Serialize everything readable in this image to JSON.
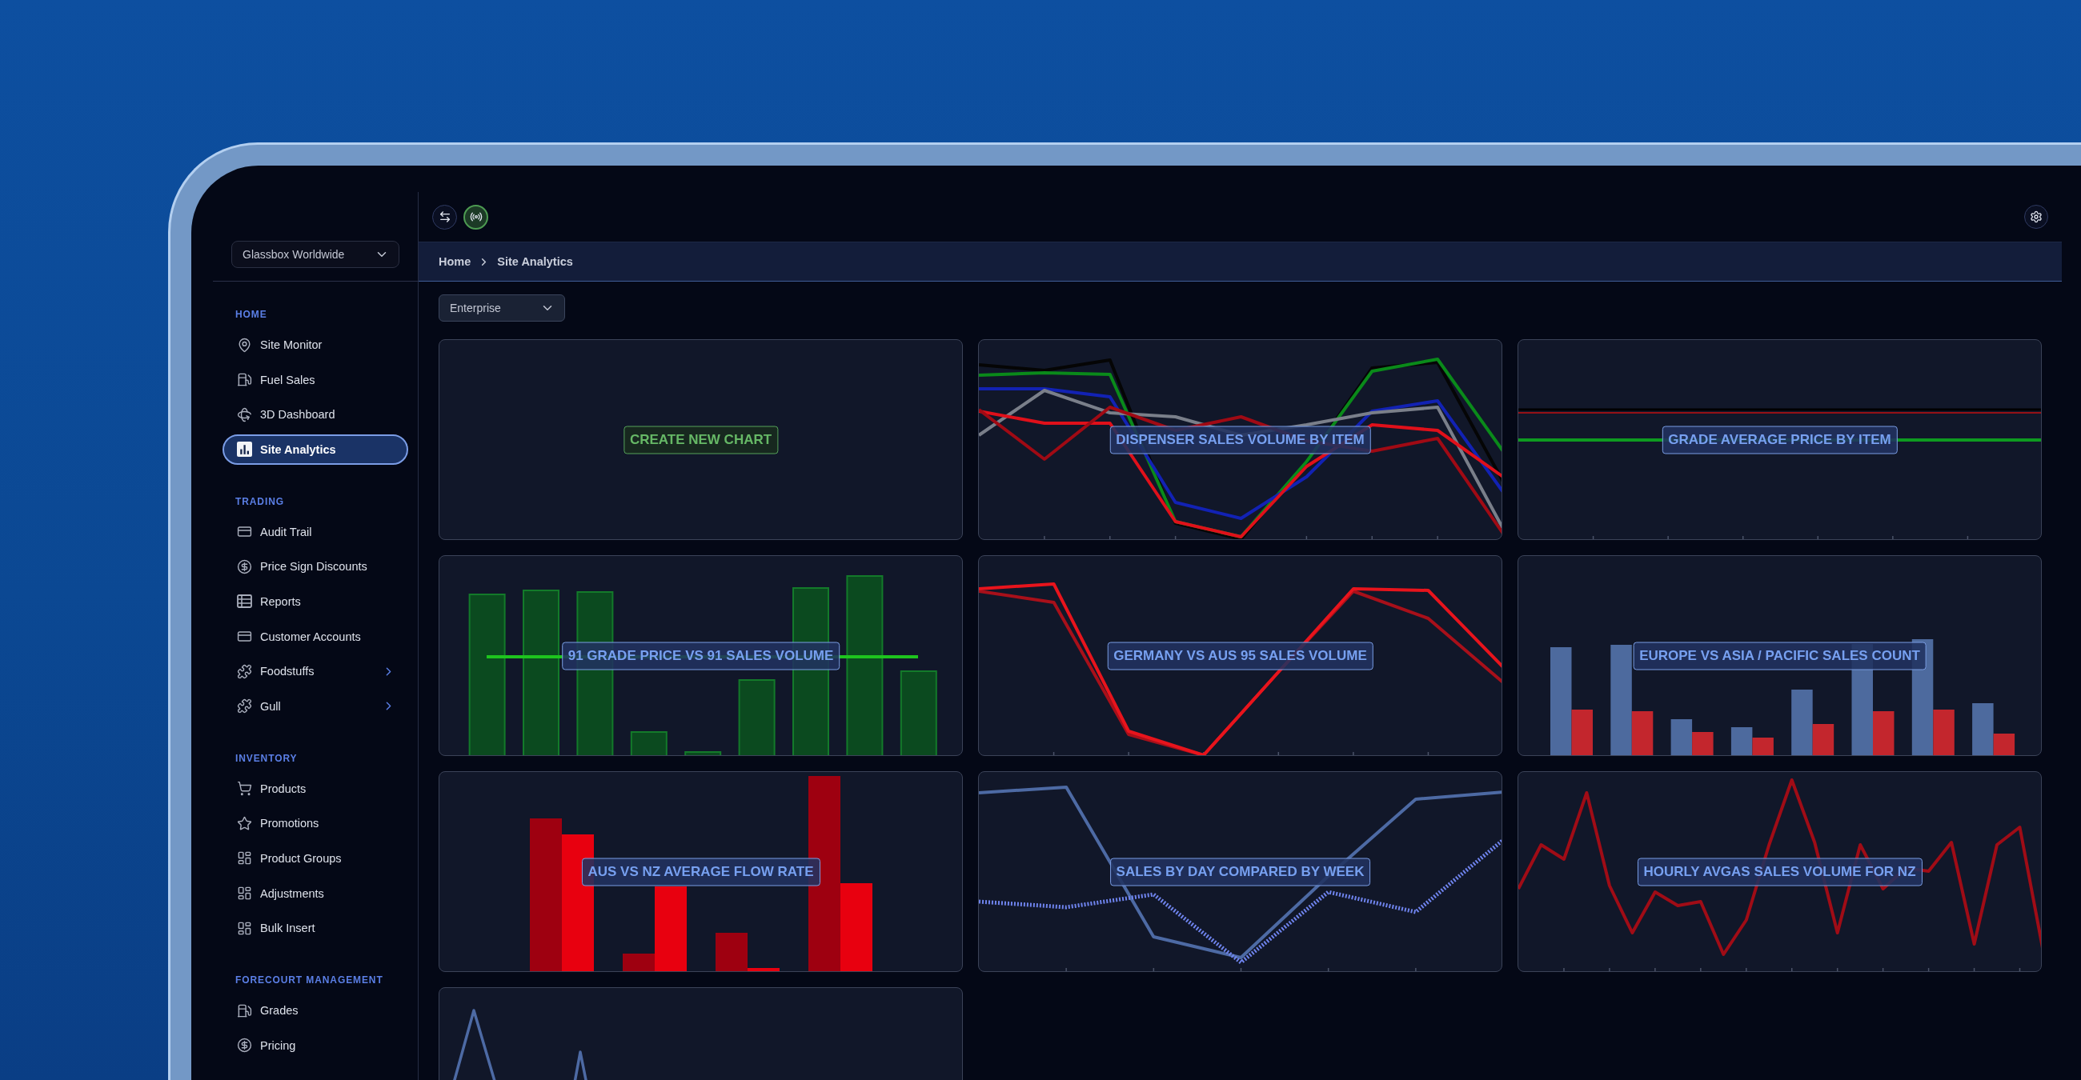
{
  "sidebar": {
    "org_selector": {
      "value": "Glassbox Worldwide"
    },
    "sections": [
      {
        "heading": "HOME",
        "items": [
          {
            "label": "Site Monitor",
            "selected": false,
            "submenu": false
          },
          {
            "label": "Fuel Sales",
            "selected": false,
            "submenu": false
          },
          {
            "label": "3D Dashboard",
            "selected": false,
            "submenu": false
          },
          {
            "label": "Site Analytics",
            "selected": true,
            "submenu": false
          }
        ]
      },
      {
        "heading": "TRADING",
        "items": [
          {
            "label": "Audit Trail",
            "selected": false,
            "submenu": false
          },
          {
            "label": "Price Sign Discounts",
            "selected": false,
            "submenu": false
          },
          {
            "label": "Reports",
            "selected": false,
            "submenu": false
          },
          {
            "label": "Customer Accounts",
            "selected": false,
            "submenu": false
          },
          {
            "label": "Foodstuffs",
            "selected": false,
            "submenu": true
          },
          {
            "label": "Gull",
            "selected": false,
            "submenu": true
          }
        ]
      },
      {
        "heading": "INVENTORY",
        "items": [
          {
            "label": "Products",
            "selected": false,
            "submenu": false
          },
          {
            "label": "Promotions",
            "selected": false,
            "submenu": false
          },
          {
            "label": "Product Groups",
            "selected": false,
            "submenu": false
          },
          {
            "label": "Adjustments",
            "selected": false,
            "submenu": false
          },
          {
            "label": "Bulk Insert",
            "selected": false,
            "submenu": false
          }
        ]
      },
      {
        "heading": "FORECOURT MANAGEMENT",
        "items": [
          {
            "label": "Grades",
            "selected": false,
            "submenu": false
          },
          {
            "label": "Pricing",
            "selected": false,
            "submenu": false
          }
        ]
      }
    ]
  },
  "breadcrumb": [
    "Home",
    "Site Analytics"
  ],
  "filter": {
    "value": "Enterprise"
  },
  "cards": [
    {
      "kind": "action",
      "title": "CREATE NEW CHART"
    },
    {
      "kind": "chart",
      "title": "DISPENSER SALES VOLUME BY ITEM"
    },
    {
      "kind": "chart",
      "title": "GRADE AVERAGE PRICE BY ITEM"
    },
    {
      "kind": "chart",
      "title": "91 GRADE PRICE VS 91 SALES VOLUME"
    },
    {
      "kind": "chart",
      "title": "GERMANY VS AUS 95 SALES VOLUME"
    },
    {
      "kind": "chart",
      "title": "EUROPE VS ASIA / PACIFIC SALES COUNT"
    },
    {
      "kind": "chart",
      "title": "AUS VS NZ AVERAGE FLOW RATE"
    },
    {
      "kind": "chart",
      "title": "SALES BY DAY COMPARED BY WEEK"
    },
    {
      "kind": "chart",
      "title": "HOURLY AVGAS SALES VOLUME FOR NZ"
    },
    {
      "kind": "chart"
    }
  ]
}
